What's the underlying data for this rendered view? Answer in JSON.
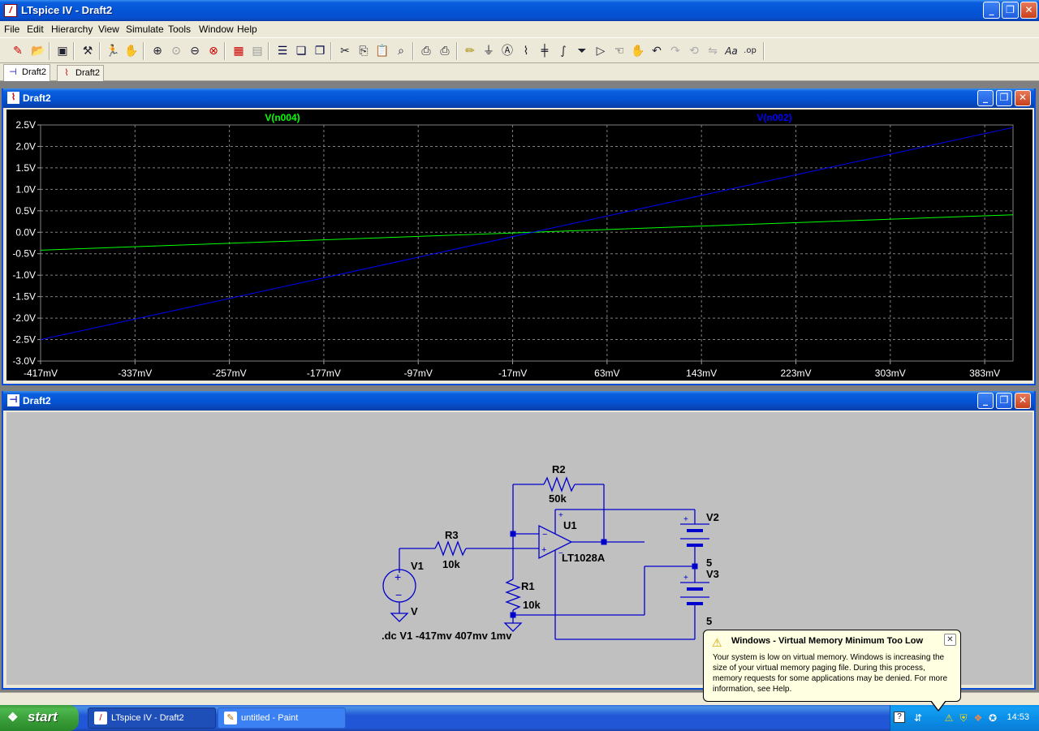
{
  "app": {
    "title": "LTspice IV - Draft2"
  },
  "menu": [
    "File",
    "Edit",
    "Hierarchy",
    "View",
    "Simulate",
    "Tools",
    "Window",
    "Help"
  ],
  "toolbar": {
    "icons": [
      "new-schematic-icon",
      "open-icon",
      "save-icon",
      "control-panel-icon",
      "run-icon",
      "halt-icon",
      "zoom-in-icon",
      "zoom-pan-icon",
      "zoom-out-icon",
      "zoom-cancel-icon",
      "autorange-icon",
      "zoom-full-icon",
      "tile-horizontal-icon",
      "cascade-icon",
      "tile-vertical-icon",
      "cut-icon",
      "copy-icon",
      "paste-icon",
      "find-icon",
      "print-setup-icon",
      "print-icon",
      "draw-wire-icon",
      "ground-icon",
      "label-net-icon",
      "resistor-icon",
      "capacitor-icon",
      "inductor-icon",
      "diode-icon",
      "component-icon",
      "move-icon",
      "drag-icon",
      "undo-icon",
      "redo-icon",
      "rotate-icon",
      "mirror-icon",
      "text-icon",
      "spice-directive-icon"
    ],
    "text_label": "Aa",
    "directive_label": ".op"
  },
  "tabs": [
    {
      "label": "Draft2",
      "kind": "schematic",
      "active": true
    },
    {
      "label": "Draft2",
      "kind": "waveform",
      "active": false
    }
  ],
  "waveform_window": {
    "title": "Draft2"
  },
  "schematic_window": {
    "title": "Draft2"
  },
  "chart_data": {
    "type": "line",
    "title": "",
    "xlabel": "",
    "ylabel": "",
    "xlim": [
      -417,
      407
    ],
    "ylim": [
      -3.0,
      2.5
    ],
    "grid": true,
    "x_ticks": [
      "-417mV",
      "-337mV",
      "-257mV",
      "-177mV",
      "-97mV",
      "-17mV",
      "63mV",
      "143mV",
      "223mV",
      "303mV",
      "383mV"
    ],
    "y_ticks": [
      "2.5V",
      "2.0V",
      "1.5V",
      "1.0V",
      "0.5V",
      "0.0V",
      "-0.5V",
      "-1.0V",
      "-1.5V",
      "-2.0V",
      "-2.5V",
      "-3.0V"
    ],
    "series": [
      {
        "name": "V(n004)",
        "color": "#00ff00",
        "x": [
          -417,
          407
        ],
        "y": [
          -0.417,
          0.407
        ]
      },
      {
        "name": "V(n002)",
        "color": "#0000ff",
        "x": [
          -417,
          407
        ],
        "y": [
          -2.502,
          2.442
        ]
      }
    ]
  },
  "schematic": {
    "r2": {
      "name": "R2",
      "value": "50k"
    },
    "r3": {
      "name": "R3",
      "value": "10k"
    },
    "r1": {
      "name": "R1",
      "value": "10k"
    },
    "u1": {
      "name": "U1",
      "value": "LT1028A"
    },
    "v1": {
      "name": "V1",
      "value": "V"
    },
    "v2": {
      "name": "V2",
      "value": "5"
    },
    "v3": {
      "name": "V3",
      "value": "5"
    },
    "directive": ".dc V1 -417mv 407mv 1mv",
    "wire_color": "#0000cc"
  },
  "taskbar": {
    "start_label": "start",
    "tasks": [
      {
        "label": "LTspice IV - Draft2",
        "active": true
      },
      {
        "label": "untitled - Paint",
        "active": false
      }
    ],
    "clock": "14:53"
  },
  "balloon": {
    "title": "Windows - Virtual Memory Minimum Too Low",
    "message": "Your system is low on virtual memory. Windows is increasing the size of your virtual memory paging file. During this process, memory requests for some applications may be denied. For more information, see Help."
  }
}
